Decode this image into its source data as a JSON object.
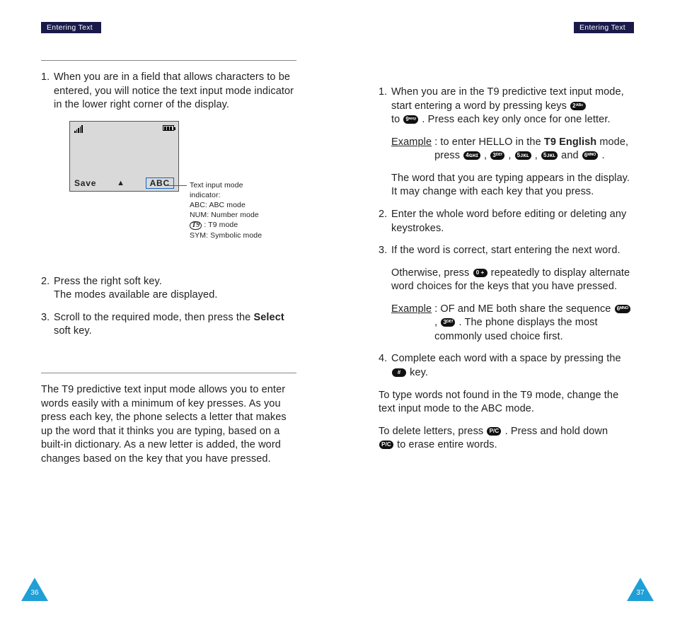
{
  "header": {
    "left": "Entering Text",
    "right": "Entering Text"
  },
  "left": {
    "items": [
      {
        "num": "1.",
        "text": "When you are in a field that allows characters to be entered, you will notice the text input mode indicator in the lower right corner of the display."
      },
      {
        "num": "2.",
        "text_a": "Press the right soft key.",
        "text_b": "The modes available are displayed."
      },
      {
        "num": "3.",
        "text_pre": "Scroll to the required mode, then press the ",
        "bold": "Select",
        "text_post": " soft key."
      }
    ],
    "phone": {
      "save": "Save",
      "abc": "ABC",
      "callout": {
        "l1": "Text input mode",
        "l2": "indicator:",
        "l3": "ABC: ABC mode",
        "l4": "NUM: Number mode",
        "l5_post": " : T9 mode",
        "l6": "SYM: Symbolic mode"
      }
    },
    "t9intro": "The T9 predictive text input mode allows you to enter words easily with a minimum of key presses. As you press each key, the phone selects a letter that makes up the word that it thinks you are typing, based on a built-in dictionary. As a new letter is added, the word changes based on the key that you have pressed.",
    "page_no": "36"
  },
  "right": {
    "items": {
      "i1": {
        "num": "1.",
        "a": "When you are in the T9 predictive text input mode, start entering a word by pressing keys ",
        "b": "to ",
        "c": " . Press each key only once for one letter.",
        "ex_label": "Example",
        "ex_a": ":  to enter HELLO in the ",
        "ex_bold": "T9 English",
        "ex_b": " mode, press ",
        "ex_and": "  and ",
        "d": "The word that you are typing appears in the display. It may change with each key that you press."
      },
      "i2": {
        "num": "2.",
        "text": "Enter the whole word before editing or deleting any keystrokes."
      },
      "i3": {
        "num": "3.",
        "text": "If the word is correct, start entering the next word.",
        "otherwise_a": "Otherwise, press ",
        "otherwise_b": "  repeatedly to display alternate word choices for the keys that you have pressed.",
        "ex_label": "Example",
        "ex_a": ":  OF and ME both share the sequence ",
        "ex_b": " . The phone displays the most commonly used choice first."
      },
      "i4": {
        "num": "4.",
        "a": "Complete each word with a space by pressing the ",
        "b": "  key."
      }
    },
    "footer1": "To type words not found in the T9 mode, change the text input mode to the ABC mode.",
    "footer2a": "To delete letters, press ",
    "footer2b": " . Press and hold down ",
    "footer2c": "  to erase entire words.",
    "page_no": "37"
  },
  "keys": {
    "k2": "2ᴬᴮᶜ",
    "k3": "3ᴰᴱᶠ",
    "k4": "4ɢʜɪ",
    "k5": "5ᴊᴋʟ",
    "k6": "6ᴹᴺᴼ",
    "k9": "9ʷˣʸ",
    "k0": "0 +",
    "hash": "#",
    "c": "P/C",
    "t9": "T9"
  }
}
